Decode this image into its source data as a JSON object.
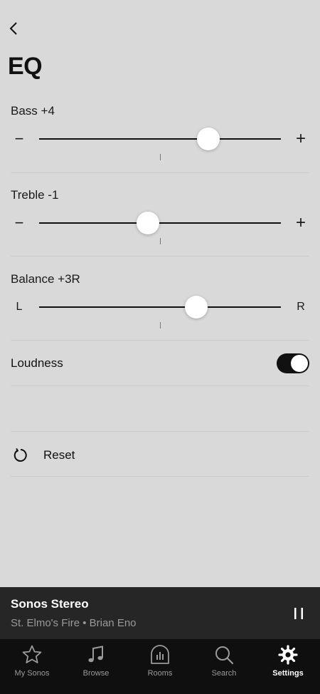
{
  "header": {
    "title": "EQ"
  },
  "sliders": [
    {
      "id": "bass",
      "label": "Bass +4",
      "left_end": "−",
      "right_end": "+",
      "value": 4,
      "min": -10,
      "max": 10
    },
    {
      "id": "treble",
      "label": "Treble -1",
      "left_end": "−",
      "right_end": "+",
      "value": -1,
      "min": -10,
      "max": 10
    },
    {
      "id": "balance",
      "label": "Balance +3R",
      "left_end": "L",
      "right_end": "R",
      "value": 3,
      "min": -10,
      "max": 10
    }
  ],
  "loudness": {
    "label": "Loudness",
    "on": true
  },
  "reset": {
    "label": "Reset"
  },
  "now_playing": {
    "room": "Sonos Stereo",
    "track": "St. Elmo's Fire • Brian Eno"
  },
  "tabs": [
    {
      "label": "My Sonos",
      "icon": "star-icon",
      "active": false
    },
    {
      "label": "Browse",
      "icon": "music-note-icon",
      "active": false
    },
    {
      "label": "Rooms",
      "icon": "rooms-icon",
      "active": false
    },
    {
      "label": "Search",
      "icon": "search-icon",
      "active": false
    },
    {
      "label": "Settings",
      "icon": "gear-icon",
      "active": true
    }
  ],
  "colors": {
    "background": "#d9d9d9",
    "now_playing_bg": "#262626",
    "tabbar_bg": "#0f0f0f",
    "accent": "#111111"
  }
}
